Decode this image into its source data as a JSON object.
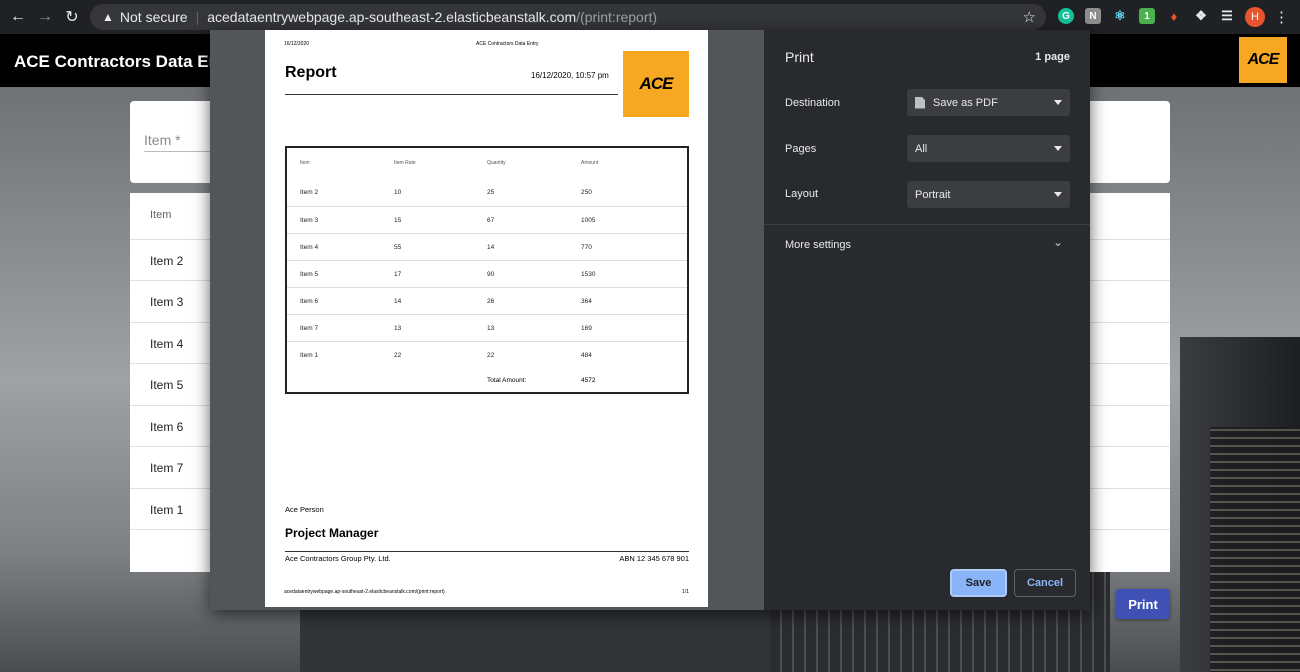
{
  "browser": {
    "security_label": "Not secure",
    "url_host": "acedataentrywebpage.ap-southeast-2.elasticbeanstalk.com",
    "url_path": "/(print:report)",
    "avatar_letter": "H",
    "ext_badge": "1"
  },
  "app": {
    "title": "ACE Contractors Data Entry",
    "logo_text": "ACE",
    "item_field_label": "Item *",
    "list_header": "Item",
    "list_items": [
      "Item 2",
      "Item 3",
      "Item 4",
      "Item 5",
      "Item 6",
      "Item 7",
      "Item 1"
    ],
    "print_button": "Print"
  },
  "report": {
    "header_date": "16/12/2020",
    "header_app": "ACE Contractors Data Entry",
    "title": "Report",
    "datetime": "16/12/2020, 10:57 pm",
    "logo_text": "ACE",
    "columns": [
      "Item",
      "Item Rate",
      "Quantity",
      "Amount"
    ],
    "rows": [
      [
        "Item 2",
        "10",
        "25",
        "250"
      ],
      [
        "Item 3",
        "15",
        "67",
        "1005"
      ],
      [
        "Item 4",
        "55",
        "14",
        "770"
      ],
      [
        "Item 5",
        "17",
        "90",
        "1530"
      ],
      [
        "Item 6",
        "14",
        "26",
        "364"
      ],
      [
        "Item 7",
        "13",
        "13",
        "169"
      ],
      [
        "Item 1",
        "22",
        "22",
        "484"
      ]
    ],
    "total_label": "Total Amount:",
    "total_value": "4572",
    "signer_name": "Ace Person",
    "signer_title": "Project Manager",
    "company": "Ace Contractors Group Pty. Ltd.",
    "abn": "ABN 12 345 678 901",
    "footer_url": "acedataentrywebpage.ap-southeast-2.elasticbeanstalk.com/(print:report)",
    "footer_page": "1/1"
  },
  "print_dialog": {
    "title": "Print",
    "page_count": "1 page",
    "destination_label": "Destination",
    "destination_value": "Save as PDF",
    "pages_label": "Pages",
    "pages_value": "All",
    "layout_label": "Layout",
    "layout_value": "Portrait",
    "more_settings": "More settings",
    "save_button": "Save",
    "cancel_button": "Cancel"
  },
  "colors": {
    "brand_orange": "#f7a823",
    "print_button_blue": "#3f51b5",
    "dialog_bg": "#292a2d",
    "save_blue": "#8ab4f8"
  }
}
